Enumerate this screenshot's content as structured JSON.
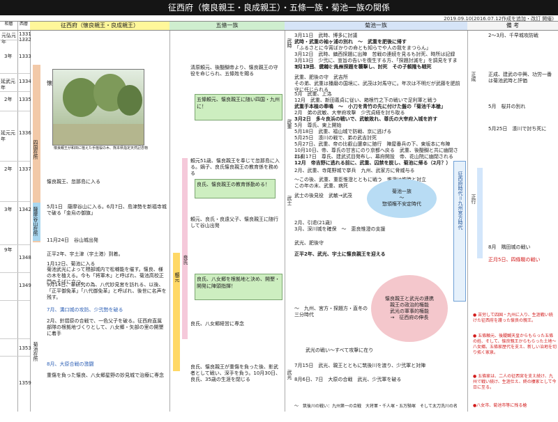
{
  "title": "征西府（懐良親王・良成親王）・五條一族・菊池一族の関係",
  "date_note": "2019.09.10(2016.07.12作成を追加・改訂 開催)",
  "headers": {
    "era": "和暦",
    "year": "西暦",
    "seisei": "征西府（懐良親王・良成親王）",
    "gojo": "五條一族",
    "kikuchi": "菊池一族",
    "nitta": "備 考"
  },
  "years": [
    "元弘元年",
    "",
    "3年",
    "",
    "",
    "延武元年",
    "2年",
    "",
    "延元元年",
    "",
    "2年",
    "",
    "3年",
    "",
    "暦応元年",
    "2年",
    "3年",
    "4年",
    "康永元年",
    "2年",
    "",
    "",
    "3年",
    "",
    "",
    "4年",
    "",
    "",
    "5年",
    "6年",
    "7年",
    "",
    "8年",
    "",
    "",
    "",
    "9年",
    "",
    "",
    "10年",
    "11年",
    "12年",
    "13年",
    "14年"
  ],
  "western": [
    "1331",
    "1332",
    "1333",
    "1334",
    "1335",
    "1336",
    "1337",
    "1338",
    "1339",
    "1340",
    "1341",
    "1342",
    "1343",
    "1344",
    "1345",
    "1346",
    "1347",
    "1348",
    "1349",
    "1350",
    "1351",
    "1352",
    "1353",
    "1354",
    "1355",
    "1356",
    "1357",
    "1358",
    "1359"
  ],
  "seisei_col": {
    "age": "懐良親王6歳",
    "photo_caption": "懐良親王が和田に植えた手植桜の木、熊本県指定天然記念物",
    "shikoku": "四国在所",
    "satsuma": "薩摩谷山在所",
    "kikuchi_zai": "菊池在所",
    "e1": "懐良親王、忽那島に入る",
    "e2": "5月1日　薩摩谷山に入る。6月7日、島津勢を新福寺城で破る「金烏の御旗」",
    "e3": "11月24日　谷山城出発",
    "e4": "正平2年、宇土津（宇土港）到着。",
    "e5": "1月12日、菊池に入る",
    "e6": "菊池武光によって隈部城内で松囃能を催す。懐良、様の木を植える。今も「将軍木」と呼ばれ、菊池高校正門のそばに立つ。",
    "e7": "9月14日、革研究の為、八代妙見宮を訪れる、以後、「正平御免革」「八代御免革」と呼ばれ、後世に名声を残す。",
    "e8": "7月、溝口城の攻防、少弐勢を破る",
    "e9": "2月、針摺原の合戦で、一色父子を破る。征西府直属部隊の根拠地づくりとして、八女郷・矢部の里の開墾に着手",
    "e10": "8月、大原合戦の激闘",
    "e11": "重傷を負った懐良、八女郷星野の妙見城で治療に専念"
  },
  "gojo_col": {
    "g1": "清原頼元、後醍醐帝より、懐良親王の守役を命じられ、五條姓を賜る",
    "badge1": "五條頼元、懐良親王に随い四国・九州に！",
    "g2": "頼元51歳、懐良親王を奉じて忽那島に入る。嫡子、良氏懐良親王の教育係を務める",
    "badge2": "良氏、懐良親王の教育係勤める！",
    "g3": "頼元、良氏・良遠父子、懐良親王に随行して谷山出発",
    "badge3": "良氏、八女郷を根拠地と決め、開墾・開発に陣頭指揮！",
    "g4": "良氏、八女郷経営に専念",
    "g5": "良氏、懐良親王が重傷を負った後、影武者として戦い、深手を負う。10月30日、良氏、35歳の生涯を閉じる",
    "side_yoshi": "良氏",
    "side_yori": "頼元"
  },
  "kikuchi_col": {
    "k1": "3月11日　武時、博多に討議",
    "k2": "武時・武重の袖ヶ浦の別れ　～　武重を肥後に帰す",
    "k3": "「ふるさとに今宵ばかりの命とも知らでや人の我をまつらん」",
    "k4": "3月12日　武時、鎮西探題に出陣　苦戦の連続を見るも討死、時所は記録",
    "k5": "3月13日　少弐に、宣旨の告いを復生する方、「探題討滅を」を調見をすませ、少弐、使者を帰る",
    "k6": "3月13日　武時、九州探題を襲撃し、討死　その子頼隆も戦死",
    "k7": "武重、肥後の守　武吉所",
    "k8": "その弟、武重は播磨の国境に、武茂は対馬守に。年次は不明だが武藤を肥前守に任じられる",
    "k9": "5月　武重、上洛",
    "k10": "12月　武重、新田義貞に従い、箱根竹之下の戦いで足利軍と戦う",
    "k11": "武重手本植の奉鳴　～　小刀を青竹の先に付けた盤の「菊池千本槍」",
    "k12": "2月　弟の武敏、大宰府攻撃　少弐貞経を討ち取る",
    "k13": "3月2日　多々良浜の戦いで、武敏敗れ、尊氏の大宰府入城を許す",
    "k14": "5月　尊氏、東上開始",
    "k15": "5月18日　武重、福山城で防戦、京に逃げる",
    "k16": "5月25日　湊川の戦で、弟の武吉討死",
    "k17": "5月27日、武重、帝の比叡山還幸に随行　陣屋番兵の下、東坂本に布陣",
    "k18": "10月10日、帝、尊氏の甘言にのり京都へ戻る　武重、後醍醐と共に幽閉される",
    "k19": "11月17日　尊氏、建武式目発布し、幕府開設　帝、花山院に幽閉される",
    "k20": "12月　帝吉野に逃れる前に、武重、囚禁を脱し、菊池に帰る（2月？）",
    "k21": "2月、武重、寺尾野城で挙兵　九州、武家方に脅威与る",
    "k22": "～この後、武重、重臣惟澄とともに戦う　惟澄は惟時と対立",
    "k23": "この年の末、武重、病死",
    "side_k1": "武時",
    "side_k2": "武重",
    "side_k3": "武士",
    "side_k4": "武光",
    "bubble1_a": "菊池一族",
    "bubble1_b": "～",
    "bubble1_c": "惣領権不安定時代",
    "k24": "武士の後見役　武敏→武茂",
    "k25": "2月、引退(21歳)",
    "k26": "3月、深川城を確保　～　恵良惟澄の支援",
    "k27": "武光、肥後守",
    "k28": "正平2年、武光、宇土に懐良親王を迎える",
    "bubble2_a": "懐良親王と武光の連携",
    "bubble2_b": "親王の政治的権能",
    "bubble2_c": "武光の軍事的権能",
    "bubble2_d": "→　征西府の伸長",
    "k29": "～　九州、宮方・探題方・直冬の三分時代",
    "k30": "武光の戦い～すべて攻撃に在り",
    "k31": "7月15日　武光、親王とともに筑後川を渡り、少弐軍と対陣",
    "k32": "8月6日、7日　大原の合戦　武光、少弐軍を破る",
    "k33": "～　筑後川の戦い：九州第一の合戦　大将軍・千人塚・五万騎塚　そして太刀洗川の名",
    "side_k5": "武光",
    "vertical_banner": "征西府時代＝九州宮方時代"
  },
  "nitta_col": {
    "n1": "2～3月、千早城攻防戦",
    "n2": "正成、建武の中興、功労一番は菊池武時と評価",
    "n3": "5月　桜井の別れ",
    "n4": "5月25日　湊川で討ち死に",
    "n5": "8月　隅田城の戦い",
    "n6": "正月5日、四條畷の戦い",
    "side_n1": "正成",
    "side_n2": "正行",
    "note1": "● 苦労して四国・九州に入り、生涯戦い続けた征西府を護った懐良の親王。",
    "note2": "● 五條頼元、後醍醐天皇からもらった五條の姓、そして、懐良親王からもらった土地～八女郷。五條家歴代を支え、新しい治地を切り拓く家泉。",
    "note3": "● 五條家は、二人の征西宮を支え続け、九州で戦い続け、生涯仕え、終の棲家として今日に至る。",
    "note4": "●八女市、菊池市等に残る槍"
  }
}
